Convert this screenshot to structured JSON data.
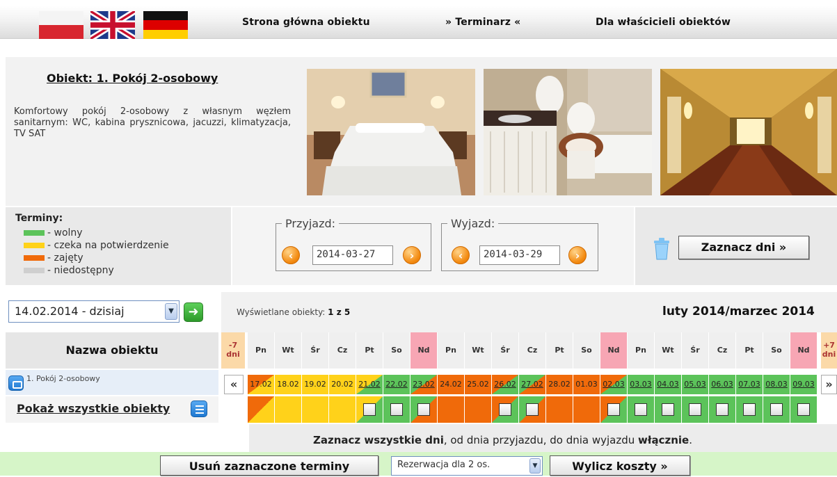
{
  "nav": {
    "flags": [
      "pl-flag",
      "uk-flag",
      "de-flag"
    ],
    "links": [
      "Strona główna obiektu",
      "» Terminarz «",
      "Dla właścicieli obiektów"
    ]
  },
  "object": {
    "title": "Obiekt: 1. Pokój 2-osobowy",
    "description": "Komfortowy pokój 2-osobowy z własnym węzłem sanitarnym: WC, kabina prysznicowa, jacuzzi, klimatyzacja, TV SAT"
  },
  "legend": {
    "title": "Terminy:",
    "items": [
      {
        "label": "- wolny",
        "color": "#5cc35a"
      },
      {
        "label": "- czeka na potwierdzenie",
        "color": "#ffd21a"
      },
      {
        "label": "- zajęty",
        "color": "#f06a0a"
      },
      {
        "label": "- niedostępny",
        "color": "#cfcfcf"
      }
    ]
  },
  "arrival": {
    "label": "Przyjazd:",
    "value": "2014-03-27"
  },
  "departure": {
    "label": "Wyjazd:",
    "value": "2014-03-29"
  },
  "mark_button": "Zaznacz dni »",
  "range_select": {
    "value": "14.02.2014 - dzisiaj"
  },
  "shown_objects": {
    "label": "Wyświetlane obiekty:",
    "value": "1 z 5"
  },
  "month_label": "luty 2014/marzec 2014",
  "name_header": "Nazwa obiektu",
  "prev_week": "-7 dni",
  "next_week": "+7 dni",
  "days": [
    "Pn",
    "Wt",
    "Śr",
    "Cz",
    "Pt",
    "So",
    "Nd",
    "Pn",
    "Wt",
    "Śr",
    "Cz",
    "Pt",
    "So",
    "Nd",
    "Pn",
    "Wt",
    "Śr",
    "Cz",
    "Pt",
    "So",
    "Nd"
  ],
  "object_row": {
    "name": "1. Pokój 2-osobowy"
  },
  "dates": [
    {
      "label": "17.02",
      "status": "occ-wait"
    },
    {
      "label": "18.02",
      "status": "wait"
    },
    {
      "label": "19.02",
      "status": "wait"
    },
    {
      "label": "20.02",
      "status": "wait"
    },
    {
      "label": "21.02",
      "status": "wait-free",
      "checkbox": true
    },
    {
      "label": "22.02",
      "status": "free",
      "checkbox": true
    },
    {
      "label": "23.02",
      "status": "free-occ",
      "checkbox": true
    },
    {
      "label": "24.02",
      "status": "occ"
    },
    {
      "label": "25.02",
      "status": "occ"
    },
    {
      "label": "26.02",
      "status": "occ-free",
      "checkbox": true
    },
    {
      "label": "27.02",
      "status": "free-occ",
      "checkbox": true
    },
    {
      "label": "28.02",
      "status": "occ"
    },
    {
      "label": "01.03",
      "status": "occ"
    },
    {
      "label": "02.03",
      "status": "occ-free",
      "checkbox": true
    },
    {
      "label": "03.03",
      "status": "free",
      "checkbox": true
    },
    {
      "label": "04.03",
      "status": "free",
      "checkbox": true
    },
    {
      "label": "05.03",
      "status": "free",
      "checkbox": true
    },
    {
      "label": "06.03",
      "status": "free",
      "checkbox": true
    },
    {
      "label": "07.03",
      "status": "free",
      "checkbox": true
    },
    {
      "label": "08.03",
      "status": "free",
      "checkbox": true
    },
    {
      "label": "09.03",
      "status": "free",
      "checkbox": true
    }
  ],
  "show_all": "Pokaż wszystkie obiekty",
  "hint": {
    "bold1": "Zaznacz wszystkie dni",
    "text": ", od dnia przyjazdu, do dnia wyjazdu ",
    "bold2": "włącznie",
    "end": "."
  },
  "bottom": {
    "remove_button": "Usuń zaznaczone terminy",
    "people_select": "Rezerwacja dla 2 os.",
    "calc_button": "Wylicz koszty »"
  },
  "colors": {
    "free": "#5cc35a",
    "wait": "#ffd21a",
    "occ": "#f06a0a",
    "sunday": "#f7a6b4"
  }
}
